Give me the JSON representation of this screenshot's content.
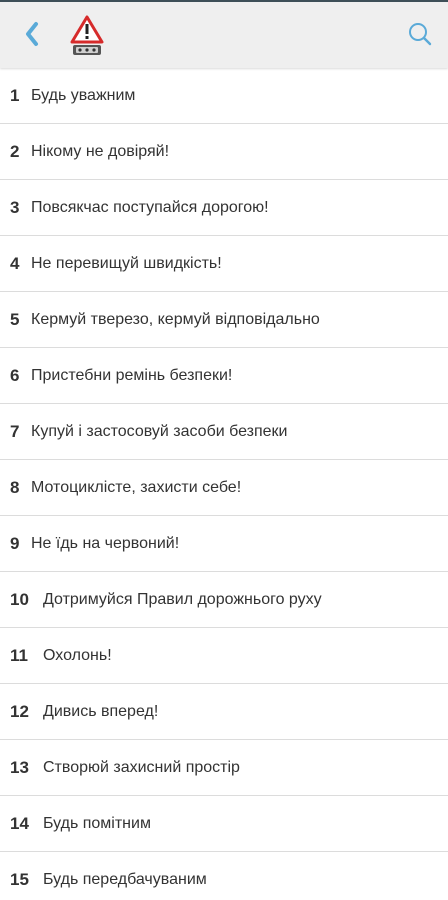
{
  "colors": {
    "toolbar_bg": "#efefef",
    "accent": "#5aaad8",
    "text": "#333333",
    "divider": "#dcdcdc"
  },
  "toolbar": {
    "back_icon": "chevron-left-icon",
    "logo_icon": "warning-triangle-car-icon",
    "search_icon": "search-icon"
  },
  "items": [
    {
      "num": "1",
      "label": "Будь уважним"
    },
    {
      "num": "2",
      "label": "Нікому не довіряй!"
    },
    {
      "num": "3",
      "label": "Повсякчас поступайся дорогою!"
    },
    {
      "num": "4",
      "label": "Не перевищуй швидкість!"
    },
    {
      "num": "5",
      "label": "Кермуй тверезо, кермуй відповідально"
    },
    {
      "num": "6",
      "label": "Пристебни ремінь безпеки!"
    },
    {
      "num": "7",
      "label": "Купуй і застосовуй засоби безпеки"
    },
    {
      "num": "8",
      "label": "Мотоциклісте, захисти себе!"
    },
    {
      "num": "9",
      "label": "Не їдь на червоний!"
    },
    {
      "num": "10",
      "label": "Дотримуйся Правил дорожнього руху"
    },
    {
      "num": "11",
      "label": "Охолонь!"
    },
    {
      "num": "12",
      "label": "Дивись вперед!"
    },
    {
      "num": "13",
      "label": "Створюй захисний простір"
    },
    {
      "num": "14",
      "label": "Будь помітним"
    },
    {
      "num": "15",
      "label": "Будь передбачуваним"
    }
  ]
}
